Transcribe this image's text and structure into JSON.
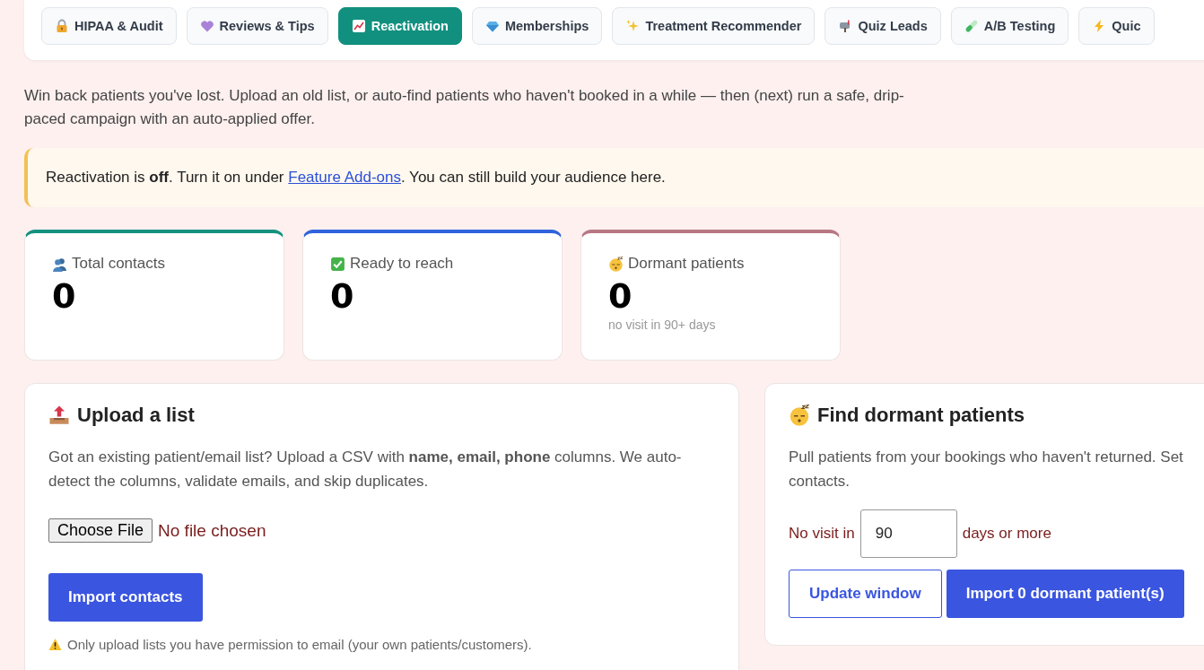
{
  "tabs": [
    {
      "label": "HIPAA & Audit",
      "selected": false
    },
    {
      "label": "Reviews & Tips",
      "selected": false
    },
    {
      "label": "Reactivation",
      "selected": true
    },
    {
      "label": "Memberships",
      "selected": false
    },
    {
      "label": "Treatment Recommender",
      "selected": false
    },
    {
      "label": "Quiz Leads",
      "selected": false
    },
    {
      "label": "A/B Testing",
      "selected": false
    },
    {
      "label": "Quic",
      "selected": false
    }
  ],
  "intro": "Win back patients you've lost. Upload an old list, or auto-find patients who haven't booked in a while — then (next) run a safe, drip-paced campaign with an auto-applied offer.",
  "notice": {
    "before": "Reactivation is **off**. Turn it on under",
    "link": "Feature Add-ons",
    "after": ". You can still build your audience here."
  },
  "stats": [
    {
      "label": "Total contacts",
      "value": "0",
      "color": "#14917f"
    },
    {
      "label": "Ready to reach",
      "value": "0",
      "color": "#2f62dc"
    },
    {
      "label": "Dormant patients",
      "value": "0",
      "note": "no visit in 90+ days",
      "color": "#b77783"
    }
  ],
  "upload": {
    "title": "Upload a list",
    "text": "Got an existing patient/email list? Upload a CSV with **name, email, phone** columns. We auto-detect the columns, validate emails, and skip duplicates.",
    "file_button": "Choose File",
    "file_status": "No file chosen",
    "button": "Import contacts",
    "warning": "Only upload lists you have permission to email (your own patients/customers)."
  },
  "dormant": {
    "title": "Find dormant patients",
    "text_lines": [
      "Pull patients from your bookings who haven't returned. Set",
      "contacts."
    ],
    "label_before": "No visit in",
    "days": "90",
    "label_after": "days or more",
    "secondary_button": "Update window",
    "primary_button": "Import 0 dormant patient(s)"
  }
}
